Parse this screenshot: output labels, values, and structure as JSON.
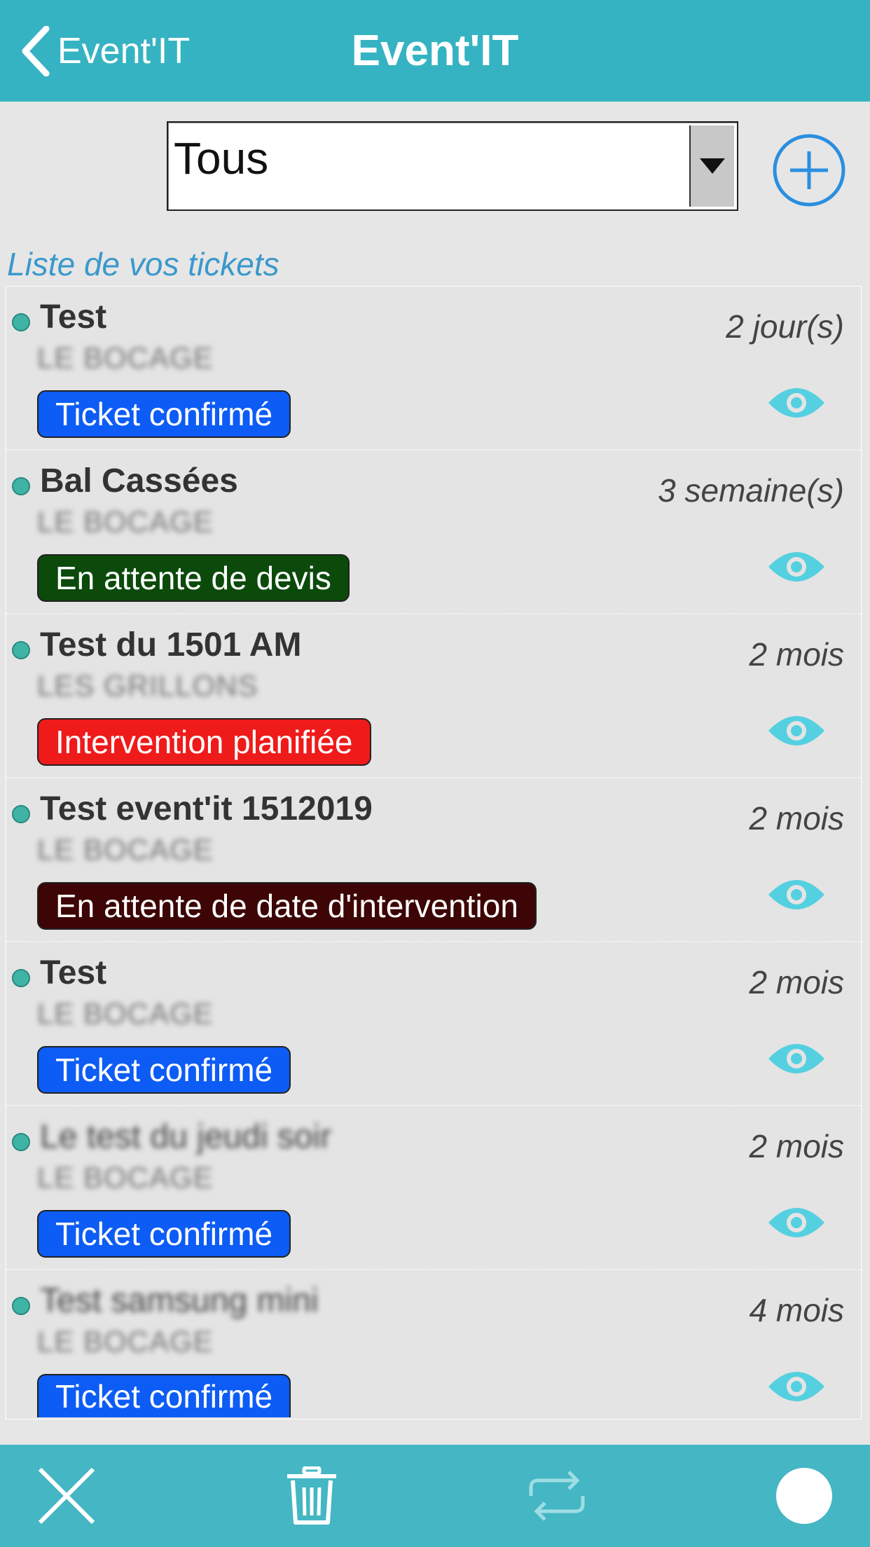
{
  "header": {
    "back_label": "Event'IT",
    "title": "Event'IT"
  },
  "filter": {
    "selected": "Tous"
  },
  "section_title": "Liste de vos tickets",
  "colors": {
    "header_bg": "#36b3c2",
    "toolbar_bg": "#44b6c4",
    "accent": "#3a99cc",
    "eye": "#55d0e0"
  },
  "tickets": [
    {
      "title": "Test",
      "location": "LE BOCAGE",
      "time": "2 jour(s)",
      "status": "Ticket confirmé",
      "status_color": "#0d5cf5",
      "title_blurred": false
    },
    {
      "title": "Bal Cassées",
      "location": "LE BOCAGE",
      "time": "3 semaine(s)",
      "status": "En attente de devis",
      "status_color": "#0b4a0b",
      "title_blurred": false
    },
    {
      "title": "Test du 1501 AM",
      "location": "LES GRILLONS",
      "time": "2 mois",
      "status": "Intervention planifiée",
      "status_color": "#ef1a1a",
      "title_blurred": false
    },
    {
      "title": "Test event'it 1512019",
      "location": "LE BOCAGE",
      "time": "2 mois",
      "status": "En attente de date d'intervention",
      "status_color": "#3d0505",
      "title_blurred": false
    },
    {
      "title": "Test",
      "location": "LE BOCAGE",
      "time": "2 mois",
      "status": "Ticket confirmé",
      "status_color": "#0d5cf5",
      "title_blurred": false
    },
    {
      "title": "Le test du jeudi soir",
      "location": "LE BOCAGE",
      "time": "2 mois",
      "status": "Ticket confirmé",
      "status_color": "#0d5cf5",
      "title_blurred": true
    },
    {
      "title": "Test samsung mini",
      "location": "LE BOCAGE",
      "time": "4 mois",
      "status": "Ticket confirmé",
      "status_color": "#0d5cf5",
      "title_blurred": true
    }
  ],
  "toolbar": {
    "icons": [
      "close-icon",
      "trash-icon",
      "sync-icon",
      "circle-icon"
    ]
  }
}
